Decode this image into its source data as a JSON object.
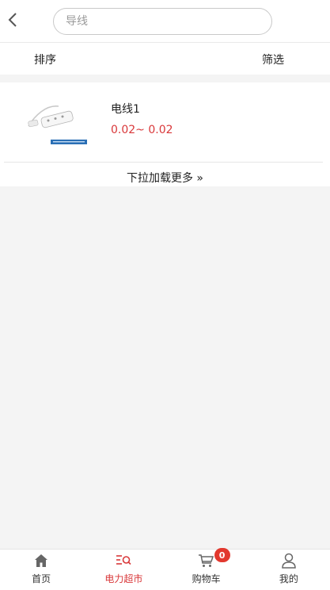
{
  "header": {
    "back_icon": "chevron-left-icon",
    "search_placeholder": "导线"
  },
  "sortbar": {
    "sort_label": "排序",
    "filter_label": "筛选"
  },
  "products": [
    {
      "name": "电线1",
      "price": "0.02~ 0.02",
      "image": "power-strip-image"
    }
  ],
  "load_more": "下拉加载更多 »",
  "tabbar": {
    "items": [
      {
        "label": "首页",
        "icon": "home-icon",
        "active": false
      },
      {
        "label": "电力超市",
        "icon": "market-list-icon",
        "active": true
      },
      {
        "label": "购物车",
        "icon": "cart-icon",
        "active": false,
        "badge": "0"
      },
      {
        "label": "我的",
        "icon": "user-icon",
        "active": false
      }
    ]
  },
  "colors": {
    "accent": "#d9383a",
    "badge": "#e2382e",
    "background": "#f4f4f4"
  }
}
